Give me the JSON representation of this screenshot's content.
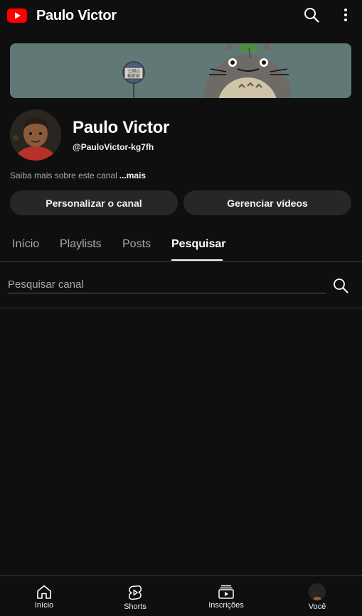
{
  "header": {
    "title": "Paulo Victor",
    "logo_icon": "youtube-logo-icon",
    "search_icon": "search-icon",
    "more_icon": "more-vertical-icon"
  },
  "banner": {
    "sign_line1": "七國山",
    "sign_line2": "稲荷前"
  },
  "channel": {
    "name": "Paulo Victor",
    "handle": "@PauloVictor-kg7fh",
    "about_text": "Saiba mais sobre este canal",
    "about_more": "...mais"
  },
  "actions": {
    "customize_label": "Personalizar o canal",
    "manage_label": "Gerenciar vídeos"
  },
  "tabs": [
    {
      "label": "Início",
      "active": false
    },
    {
      "label": "Playlists",
      "active": false
    },
    {
      "label": "Posts",
      "active": false
    },
    {
      "label": "Pesquisar",
      "active": true
    }
  ],
  "search": {
    "placeholder": "Pesquisar canal",
    "value": ""
  },
  "bottom_nav": [
    {
      "label": "Início",
      "icon": "home-icon"
    },
    {
      "label": "Shorts",
      "icon": "shorts-icon"
    },
    {
      "label": "Inscrições",
      "icon": "subscriptions-icon"
    },
    {
      "label": "Você",
      "icon": "avatar"
    }
  ],
  "colors": {
    "background": "#0f0f0f",
    "brand_red": "#ff0000",
    "button_bg": "#272727",
    "secondary_text": "#aaaaaa"
  }
}
